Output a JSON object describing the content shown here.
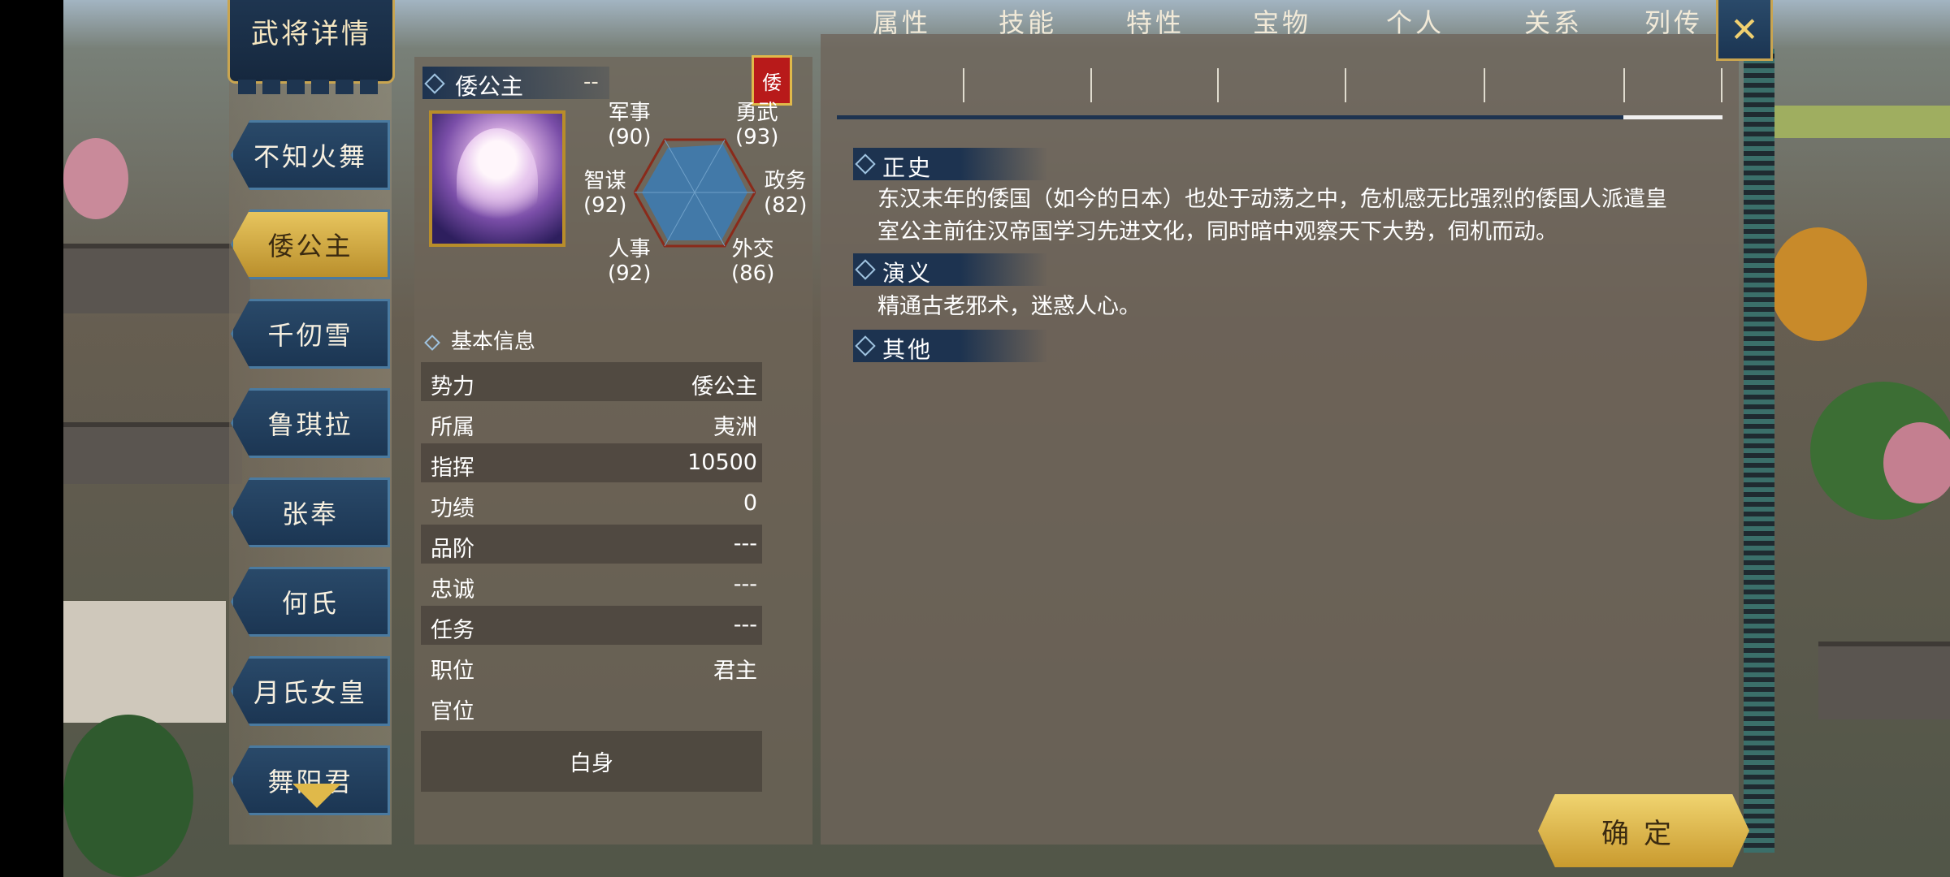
{
  "header": {
    "title": "武将详情"
  },
  "list": {
    "items": [
      {
        "label": "不知火舞"
      },
      {
        "label": "倭公主",
        "active": true
      },
      {
        "label": "千仞雪"
      },
      {
        "label": "鲁琪拉"
      },
      {
        "label": "张奉"
      },
      {
        "label": "何氏"
      },
      {
        "label": "月氏女皇"
      },
      {
        "label": "舞阳君"
      }
    ]
  },
  "general": {
    "name": "倭公主",
    "name_suffix": "--",
    "faction_tag": "倭",
    "stats": {
      "military": {
        "label": "军事",
        "value": "(90)"
      },
      "valor": {
        "label": "勇武",
        "value": "(93)"
      },
      "strategy": {
        "label": "智谋",
        "value": "(92)"
      },
      "politics": {
        "label": "政务",
        "value": "(82)"
      },
      "personnel": {
        "label": "人事",
        "value": "(92)"
      },
      "diplomacy": {
        "label": "外交",
        "value": "(86)"
      }
    }
  },
  "basic_info": {
    "heading": "基本信息",
    "rows": [
      {
        "key": "势力",
        "value": "倭公主"
      },
      {
        "key": "所属",
        "value": "夷洲"
      },
      {
        "key": "指挥",
        "value": "10500"
      },
      {
        "key": "功绩",
        "value": "0"
      },
      {
        "key": "品阶",
        "value": "---"
      },
      {
        "key": "忠诚",
        "value": "---"
      },
      {
        "key": "任务",
        "value": "---"
      },
      {
        "key": "职位",
        "value": "君主"
      },
      {
        "key": "官位",
        "value": ""
      }
    ],
    "office": "白身"
  },
  "tabs": [
    {
      "label": "属性"
    },
    {
      "label": "技能"
    },
    {
      "label": "特性"
    },
    {
      "label": "宝物"
    },
    {
      "label": "个人"
    },
    {
      "label": "关系"
    },
    {
      "label": "列传",
      "active": true
    }
  ],
  "biography": {
    "sections": [
      {
        "title": "正史",
        "text_lines": [
          "东汉末年的倭国（如今的日本）也处于动荡之中，危机感无比强烈的倭国人派遣皇",
          "室公主前往汉帝国学习先进文化，同时暗中观察天下大势，伺机而动。"
        ]
      },
      {
        "title": "演义",
        "text_lines": [
          "精通古老邪术，迷惑人心。"
        ]
      },
      {
        "title": "其他",
        "text_lines": []
      }
    ]
  },
  "buttons": {
    "confirm": "确定",
    "close": "✕"
  },
  "colors": {
    "navy": "#1d3350",
    "gold": "#c99a2e",
    "tag_red": "#b81a1a"
  }
}
